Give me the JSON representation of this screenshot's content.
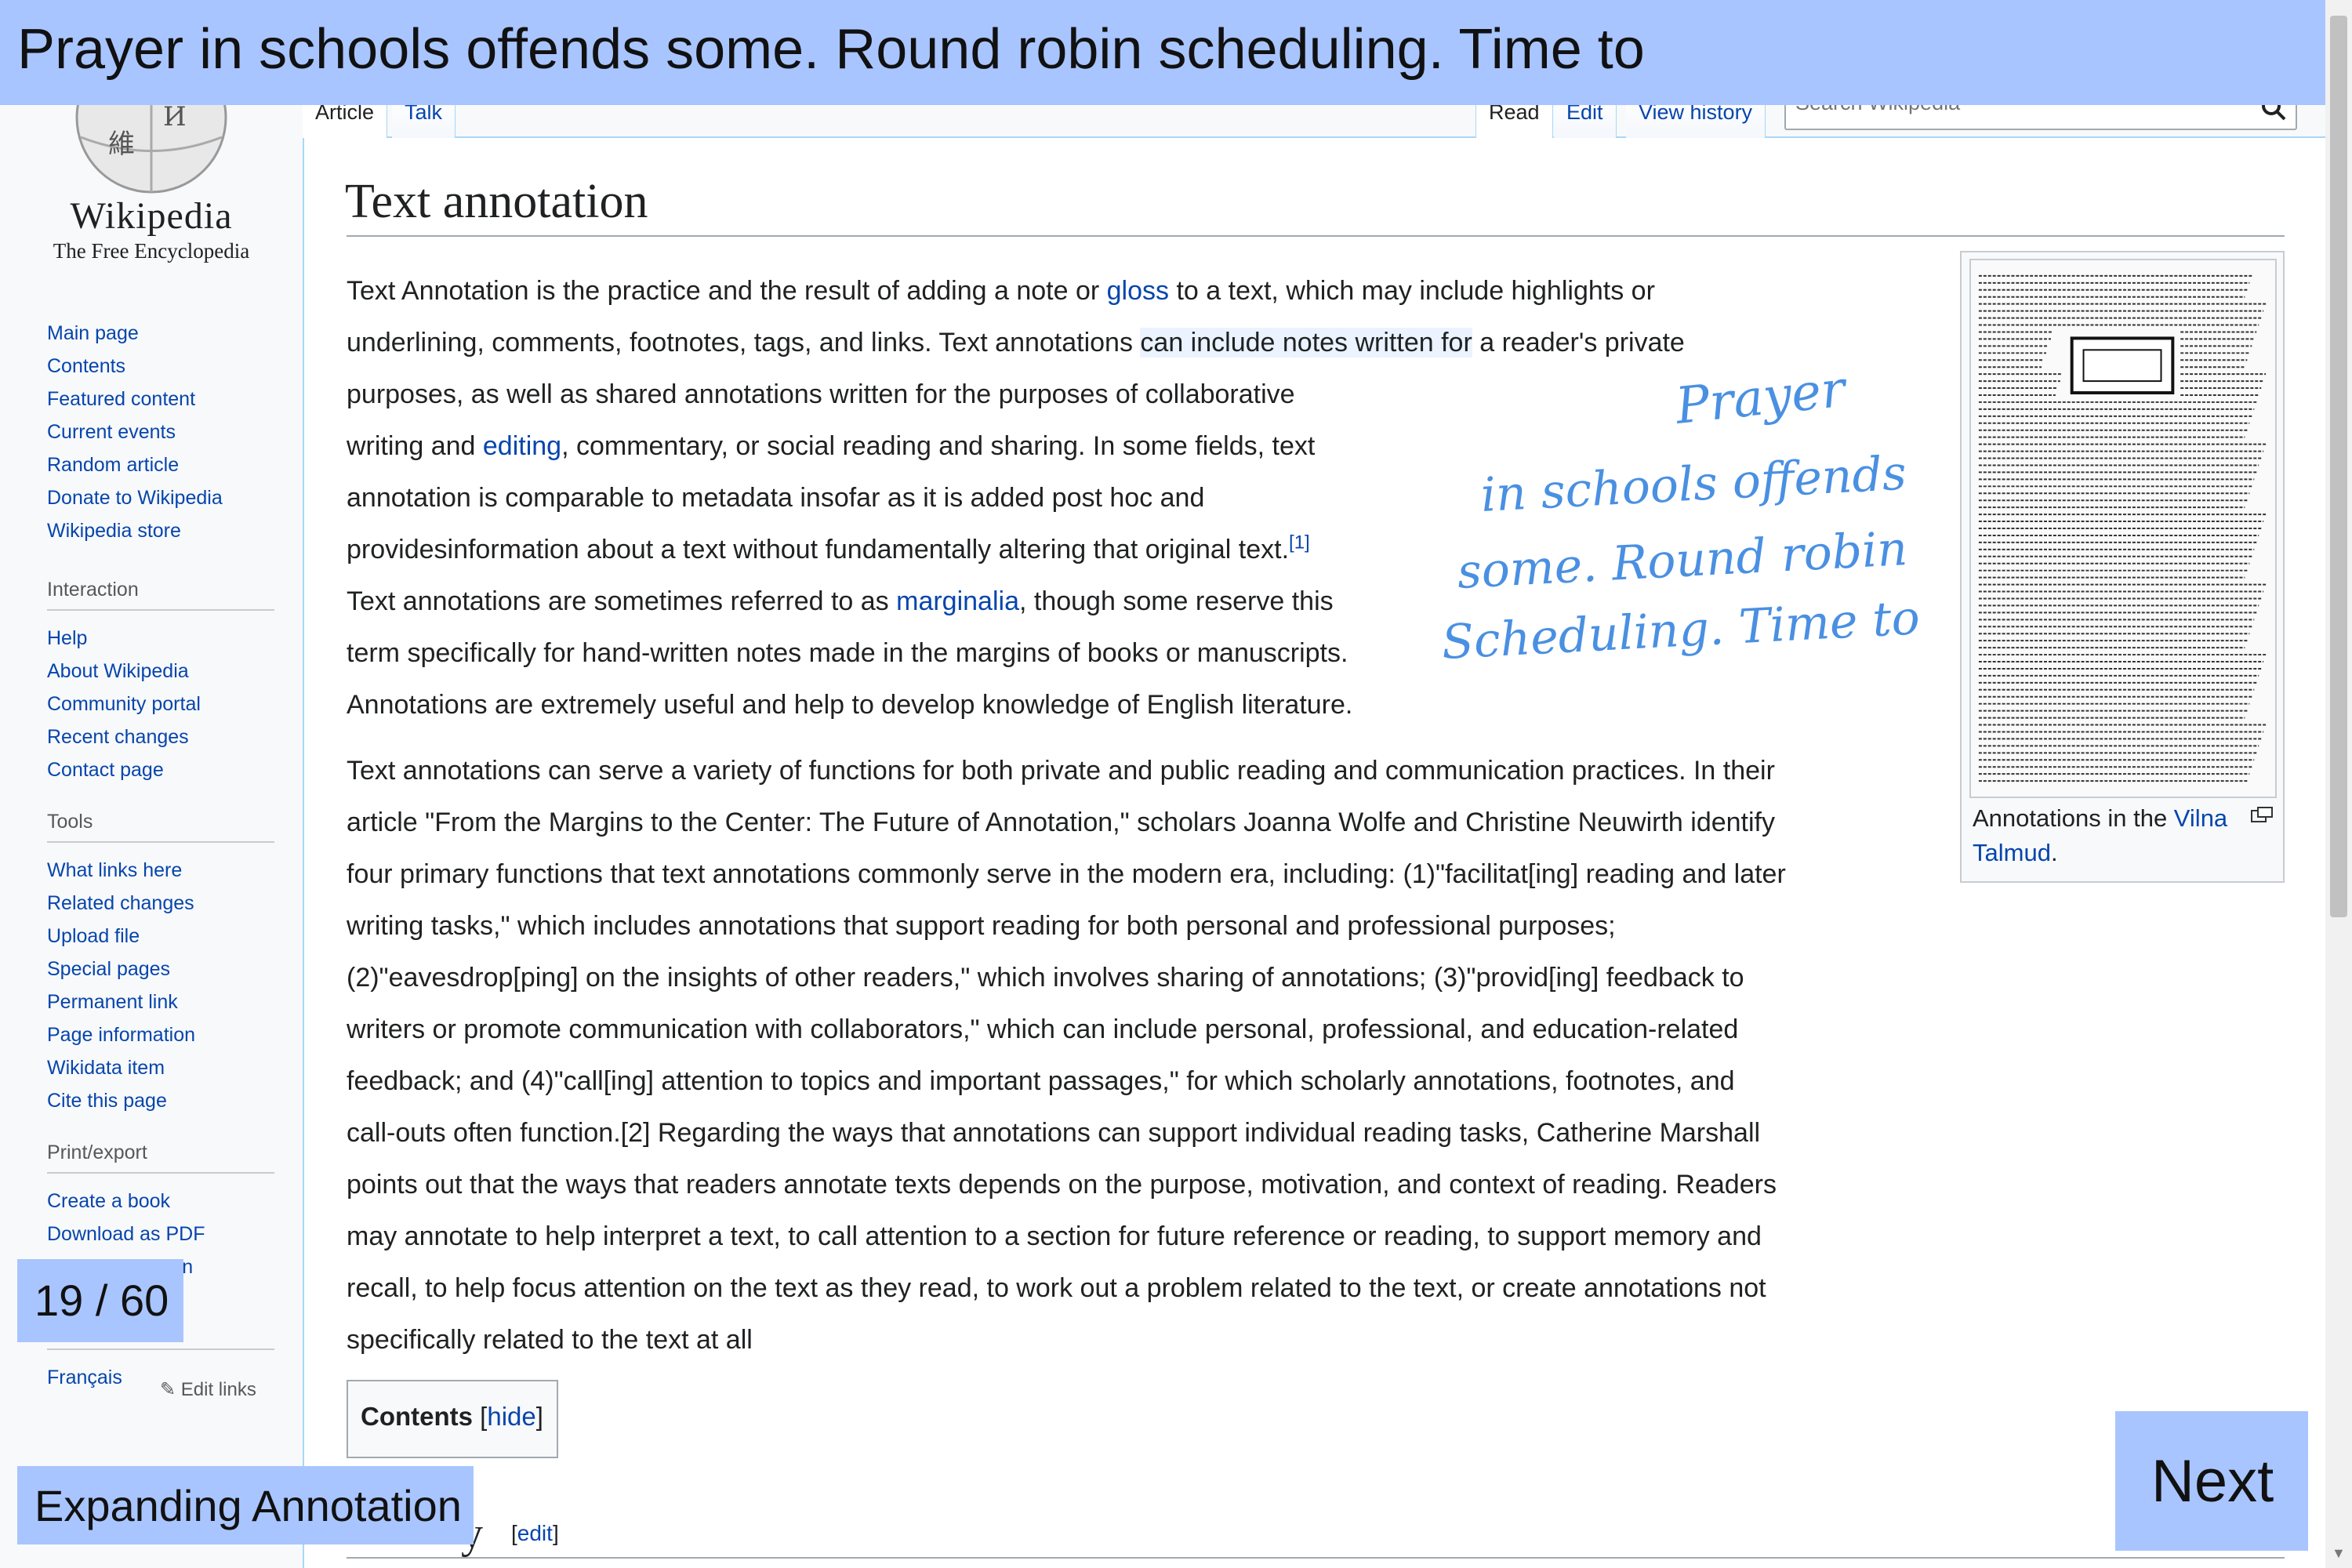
{
  "banner": {
    "text": "Prayer in schools offends some. Round robin scheduling. Time to"
  },
  "logo": {
    "title": "Wikipedia",
    "tagline": "The Free Encyclopedia"
  },
  "sidebar": {
    "main": [
      "Main page",
      "Contents",
      "Featured content",
      "Current events",
      "Random article",
      "Donate to Wikipedia",
      "Wikipedia store"
    ],
    "interaction_heading": "Interaction",
    "interaction": [
      "Help",
      "About Wikipedia",
      "Community portal",
      "Recent changes",
      "Contact page"
    ],
    "tools_heading": "Tools",
    "tools": [
      "What links here",
      "Related changes",
      "Upload file",
      "Special pages",
      "Permanent link",
      "Page information",
      "Wikidata item",
      "Cite this page"
    ],
    "print_heading": "Print/export",
    "print": [
      "Create a book",
      "Download as PDF",
      "Printable version"
    ],
    "languages": [
      "Français"
    ],
    "edit_links": "Edit links"
  },
  "tabs": {
    "article": "Article",
    "talk": "Talk",
    "read": "Read",
    "edit": "Edit",
    "history": "View history"
  },
  "search": {
    "placeholder": "Search Wikipedia"
  },
  "article": {
    "title": "Text annotation",
    "p1": {
      "l1a": "Text Annotation is the practice and the result of adding a note or ",
      "l1link": "gloss",
      "l1b": " to a text, which may include highlights or",
      "l2a": "underlining, comments, footnotes, tags, and links. Text annotations ",
      "l2hl": "can include notes written for",
      "l2b": " a reader's private",
      "l3": "purposes, as well as shared annotations written for the purposes of collaborative",
      "l4a": "writing and ",
      "l4link": "editing",
      "l4b": ", commentary, or social reading and sharing. In some fields, text",
      "l5": "annotation is comparable to metadata insofar as it is added post hoc and",
      "l6": "providesinformation about a text without fundamentally altering that original text.",
      "l6ref": "[1]",
      "l7a": "Text annotations are sometimes referred to as ",
      "l7link": "marginalia",
      "l7b": ", though some reserve this",
      "l8": "term specifically for hand-written notes made in the margins of books or manuscripts.",
      "l9": "Annotations are extremely useful and help to develop knowledge of English literature."
    },
    "p2": [
      "Text annotations can serve a variety of functions for both private and public reading and communication practices. In their",
      "article \"From the Margins to the Center: The Future of Annotation,\" scholars Joanna Wolfe and Christine Neuwirth identify",
      "four primary functions that text annotations commonly serve in the modern era, including: (1)\"facilitat[ing] reading and later",
      "writing tasks,\" which includes annotations that support reading for both personal and professional purposes;",
      "(2)\"eavesdrop[ping] on the insights of other readers,\" which involves sharing of annotations; (3)\"provid[ing] feedback to",
      "writers or promote communication with collaborators,\" which can include personal, professional, and education-related",
      "feedback; and (4)\"call[ing] attention to topics and important passages,\" for which scholarly annotations, footnotes, and",
      "call-outs often function.[2] Regarding the ways that annotations can support individual reading tasks, Catherine Marshall",
      "points out that the ways that readers annotate texts depends on the purpose, motivation, and context of reading. Readers",
      "may annotate to help interpret a text, to call attention to a section for future reference or reading, to support memory and",
      "recall, to help focus attention on the text as they read, to work out a problem related to the text, or create annotations not",
      "specifically related to the text at all"
    ],
    "thumb_caption_a": "Annotations in the ",
    "thumb_caption_link": "Vilna Talmud",
    "thumb_caption_b": ".",
    "toc_label": "Contents",
    "toc_hide": "hide",
    "section_tail": "y",
    "section_edit": "edit"
  },
  "ink": {
    "lines": [
      "Prayer",
      "in schools offends",
      "some. Round robin",
      "Scheduling. Time to"
    ],
    "color": "#4a90e2"
  },
  "overlay": {
    "counter": "19 / 60",
    "mode": "Expanding Annotation",
    "next": "Next",
    "color": "#a8c5ff"
  }
}
